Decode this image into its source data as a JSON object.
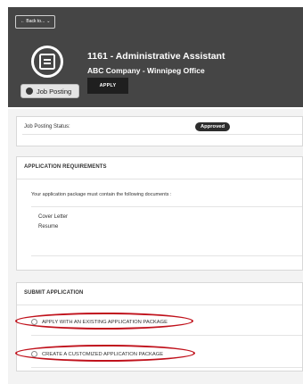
{
  "header": {
    "back_label": "← Back to...",
    "back_chevron": "⌄",
    "job_title": "1161 - Administrative Assistant",
    "company": "ABC Company - Winnipeg Office",
    "apply_label": "APPLY",
    "badge_label": "Job Posting",
    "logo_icon": "document-icon"
  },
  "status": {
    "label": "Job Posting Status:",
    "value": "Approved"
  },
  "requirements": {
    "heading": "APPLICATION REQUIREMENTS",
    "intro": "Your application package must contain the following documents :",
    "documents": [
      "Cover Letter",
      "Resume"
    ]
  },
  "submit": {
    "heading": "SUBMIT APPLICATION",
    "options": [
      "APPLY WITH AN EXISTING APPLICATION PACKAGE",
      "CREATE A CUSTOMIZED APPLICATION PACKAGE"
    ]
  },
  "colors": {
    "header_bg": "#454545",
    "highlight": "#c0121c",
    "pill_bg": "#2d2d2d"
  }
}
